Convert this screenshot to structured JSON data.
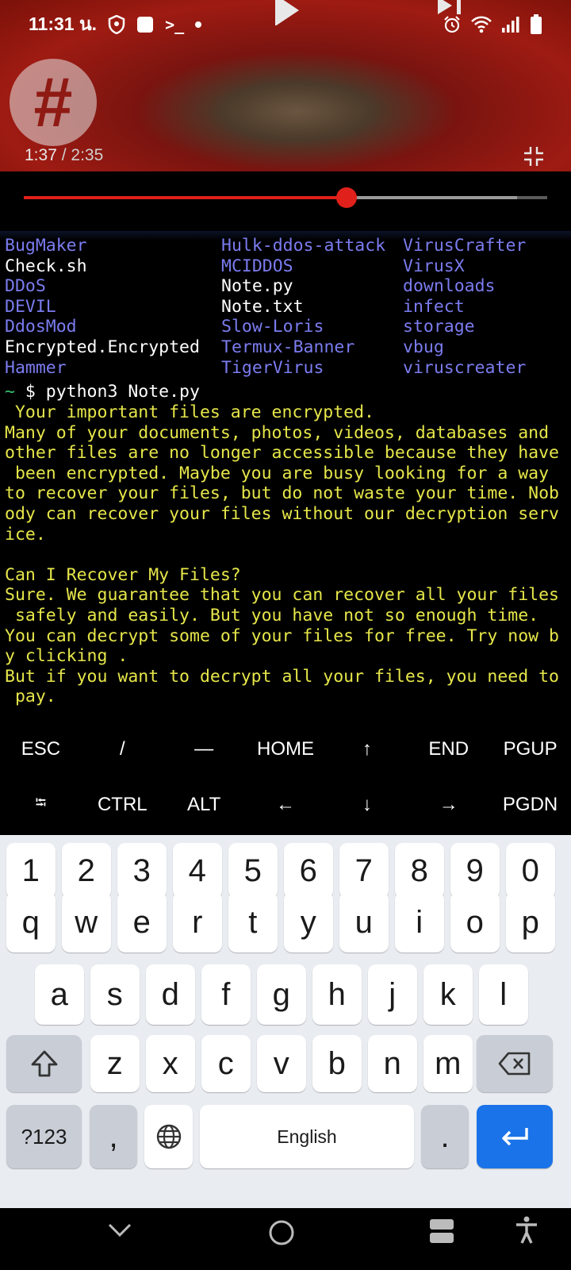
{
  "status_bar": {
    "time": "11:31 น."
  },
  "video": {
    "current_time": "1:37",
    "duration": "/ 2:35",
    "progress_fraction": 0.616,
    "buffered_fraction": 0.943,
    "logo_glyph": "#"
  },
  "terminal": {
    "ls_rows": [
      [
        {
          "t": "BugMaker",
          "c": "dir"
        },
        {
          "t": "Hulk-ddos-attack",
          "c": "dir"
        },
        {
          "t": "VirusCrafter",
          "c": "dir"
        }
      ],
      [
        {
          "t": "Check.sh",
          "c": "file"
        },
        {
          "t": "MCIDDOS",
          "c": "dir"
        },
        {
          "t": "VirusX",
          "c": "dir"
        }
      ],
      [
        {
          "t": "DDoS",
          "c": "dir"
        },
        {
          "t": "Note.py",
          "c": "file"
        },
        {
          "t": "downloads",
          "c": "dir"
        }
      ],
      [
        {
          "t": "DEVIL",
          "c": "dir"
        },
        {
          "t": "Note.txt",
          "c": "file"
        },
        {
          "t": "infect",
          "c": "dir"
        }
      ],
      [
        {
          "t": "DdosMod",
          "c": "dir"
        },
        {
          "t": "Slow-Loris",
          "c": "dir"
        },
        {
          "t": "storage",
          "c": "dir"
        }
      ],
      [
        {
          "t": "Encrypted.Encrypted",
          "c": "file"
        },
        {
          "t": "Termux-Banner",
          "c": "dir"
        },
        {
          "t": "vbug",
          "c": "dir"
        }
      ],
      [
        {
          "t": "Hammer",
          "c": "dir"
        },
        {
          "t": "TigerVirus",
          "c": "dir"
        },
        {
          "t": "viruscreater",
          "c": "dir"
        }
      ]
    ],
    "prompt_symbol": "~",
    "command": " $ python3 Note.py",
    "output_lines": [
      " Your important files are encrypted.",
      "Many of your documents, photos, videos, databases and",
      "other files are no longer accessible because they have",
      " been encrypted. Maybe you are busy looking for a way",
      "to recover your files, but do not waste your time. Nob",
      "ody can recover your files without our decryption serv",
      "ice.",
      "",
      "Can I Recover My Files?",
      "Sure. We guarantee that you can recover all your files",
      " safely and easily. But you have not so enough time.",
      "You can decrypt some of your files for free. Try now b",
      "y clicking .",
      "But if you want to decrypt all your files, you need to",
      " pay."
    ]
  },
  "extra_keys": {
    "row1": [
      "ESC",
      "/",
      "—",
      "HOME",
      "↑",
      "END",
      "PGUP"
    ],
    "row2": [
      "⭾",
      "CTRL",
      "ALT",
      "←",
      "↓",
      "→",
      "PGDN"
    ]
  },
  "keyboard": {
    "numbers": [
      "1",
      "2",
      "3",
      "4",
      "5",
      "6",
      "7",
      "8",
      "9",
      "0"
    ],
    "row_q": [
      "q",
      "w",
      "e",
      "r",
      "t",
      "y",
      "u",
      "i",
      "o",
      "p"
    ],
    "row_a": [
      "a",
      "s",
      "d",
      "f",
      "g",
      "h",
      "j",
      "k",
      "l"
    ],
    "row_z": [
      "z",
      "x",
      "c",
      "v",
      "b",
      "n",
      "m"
    ],
    "symbols_key": "?123",
    "comma_key": ",",
    "space_label": "English",
    "period_key": "."
  }
}
